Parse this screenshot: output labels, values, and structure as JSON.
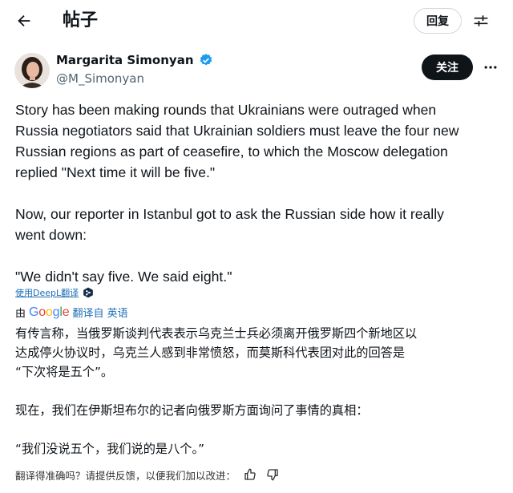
{
  "header": {
    "title": "帖子",
    "reply_label": "回复",
    "back_icon": "arrow-left-icon",
    "settings_icon": "sliders-icon"
  },
  "author": {
    "name": "Margarita Simonyan",
    "handle": "@M_Simonyan",
    "verified": true,
    "follow_label": "关注",
    "verified_color": "#1d9bf0"
  },
  "tweet": {
    "lines_p1": [
      "Story has been making rounds that Ukrainians were outraged when",
      "Russia negotiators said that Ukrainian soldiers must leave the four new",
      "Russian regions as part of ceasefire, to which the Moscow delegation",
      "replied \"Next time it will be five.\""
    ],
    "lines_p2": [
      "Now, our reporter in Istanbul got to ask the Russian side how it really",
      "went down:"
    ],
    "line_p3": "\"We didn't say five. We said eight.\""
  },
  "translation": {
    "deepl_label": "使用DeepL翻译",
    "by_label": "由",
    "google_logo": "Google",
    "translated_from": "翻译自 英语",
    "zh_p1": [
      "有传言称，当俄罗斯谈判代表表示乌克兰士兵必须离开俄罗斯四个新地区以",
      "达成停火协议时，乌克兰人感到非常愤怒，而莫斯科代表团对此的回答是",
      "“下次将是五个”。"
    ],
    "zh_p2": "现在，我们在伊斯坦布尔的记者向俄罗斯方面询问了事情的真相：",
    "zh_p3": "“我们没说五个，我们说的是八个。”",
    "feedback_prompt": "翻译得准确吗？请提供反馈，以便我们加以改进："
  }
}
